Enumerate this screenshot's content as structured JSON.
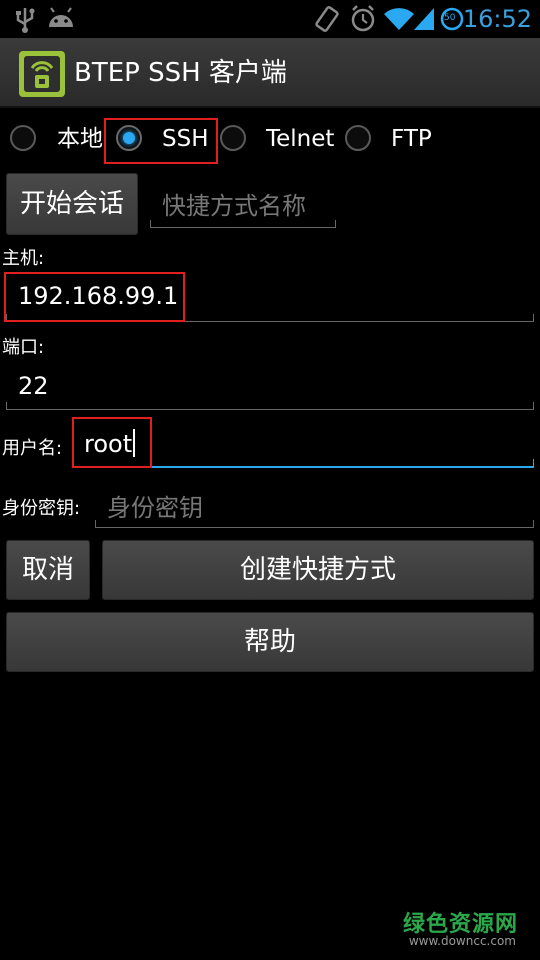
{
  "status_bar": {
    "time": "16:52",
    "icons": [
      "usb-icon",
      "android-icon",
      "vibrate-icon",
      "alarm-icon",
      "wifi-icon",
      "signal-icon",
      "battery-icon"
    ],
    "battery_level": "50"
  },
  "app": {
    "title": "BTEP SSH 客户端"
  },
  "connection_types": [
    {
      "label": "本地",
      "selected": false
    },
    {
      "label": "SSH",
      "selected": true
    },
    {
      "label": "Telnet",
      "selected": false
    },
    {
      "label": "FTP",
      "selected": false
    }
  ],
  "session": {
    "start_button": "开始会话",
    "shortcut_name_placeholder": "快捷方式名称"
  },
  "form": {
    "host_label": "主机:",
    "host_value": "192.168.99.1",
    "port_label": "端口:",
    "port_value": "22",
    "username_label": "用户名:",
    "username_value": "root",
    "key_label": "身份密钥:",
    "key_placeholder": "身份密钥"
  },
  "actions": {
    "cancel": "取消",
    "create_shortcut": "创建快捷方式",
    "help": "帮助"
  },
  "watermark": {
    "main": "绿色资源网",
    "url": "www.downcc.com"
  },
  "colors": {
    "accent": "#2aa8f2",
    "highlight_box": "#e02020",
    "watermark": "#2aa84a"
  }
}
